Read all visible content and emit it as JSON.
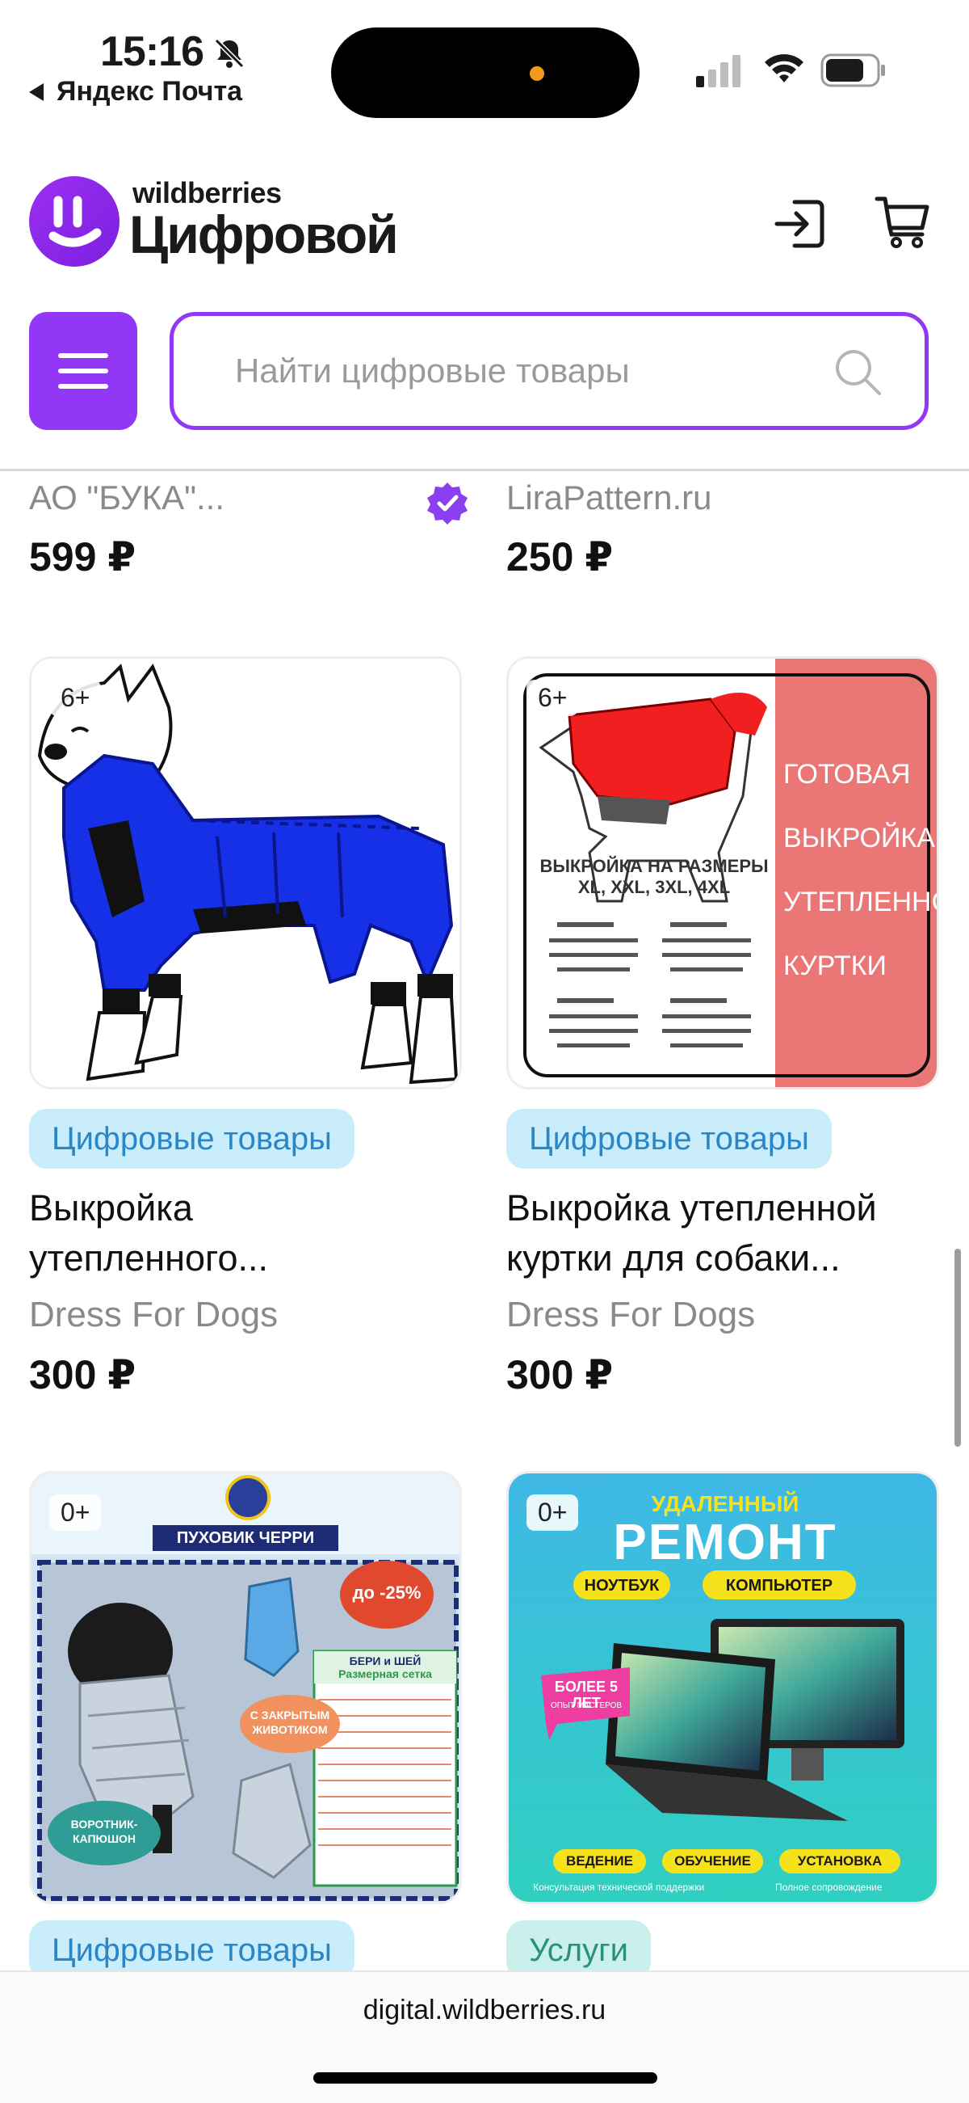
{
  "status_bar": {
    "time": "15:16",
    "back_app": "Яндекс Почта"
  },
  "header": {
    "brand_small": "wildberries",
    "brand_title": "Цифровой"
  },
  "search": {
    "placeholder": "Найти цифровые товары"
  },
  "top_row": [
    {
      "seller": "АО \"БУКА\"...",
      "price": "599 ₽",
      "verified": true
    },
    {
      "seller": "LiraPattern.ru",
      "price": "250 ₽",
      "verified": false
    }
  ],
  "products": [
    {
      "age": "6+",
      "category": "Цифровые товары",
      "title_line1": "Выкройка",
      "title_line2": "утепленного...",
      "seller": "Dress For Dogs",
      "price": "300 ₽",
      "image_text": {}
    },
    {
      "age": "6+",
      "category": "Цифровые товары",
      "title_line1": "Выкройка утепленной",
      "title_line2": "куртки для собаки...",
      "seller": "Dress For Dogs",
      "price": "300 ₽",
      "image_text": {
        "side_1": "ГОТОВАЯ",
        "side_2": "ВЫКРОЙКА",
        "side_3": "УТЕПЛЕННОЙ",
        "side_4": "КУРТКИ",
        "heading": "ВЫКРОЙКА НА РАЗМЕРЫ",
        "sizes": "XL, XXL, 3XL, 4XL"
      }
    },
    {
      "age": "0+",
      "category": "Цифровые товары",
      "image_text": {
        "banner": "ПУХОВИК ЧЕРРИ",
        "discount": "до -25%",
        "belly": "С ЗАКРЫТЫМ ЖИВОТИКОМ",
        "collar": "ВОРОТНИК-КАПЮШОН",
        "brand": "БЕРИ и ШЕЙ",
        "chart": "Размерная сетка"
      }
    },
    {
      "age": "0+",
      "category": "Услуги",
      "image_text": {
        "line1": "УДАЛЕННЫЙ",
        "line2": "РЕМОНТ",
        "tag1": "НОУТБУК",
        "tag2": "КОМПЬЮТЕР",
        "years": "БОЛЕЕ 5 ЛЕТ",
        "exp": "ОПЫТ МАСТЕРОВ",
        "b1": "ВЕДЕНИЕ",
        "b2": "ОБУЧЕНИЕ",
        "b3": "УСТАНОВКА",
        "foot1": "Консультация технической поддержки",
        "foot2": "Полное сопровождение"
      }
    }
  ],
  "browser": {
    "url": "digital.wildberries.ru"
  },
  "colors": {
    "accent": "#9237f5",
    "badge_bg": "#c9edfb",
    "badge_text": "#2a86c6",
    "service_bg": "#c9f0ea",
    "service_text": "#2b8f7e"
  }
}
